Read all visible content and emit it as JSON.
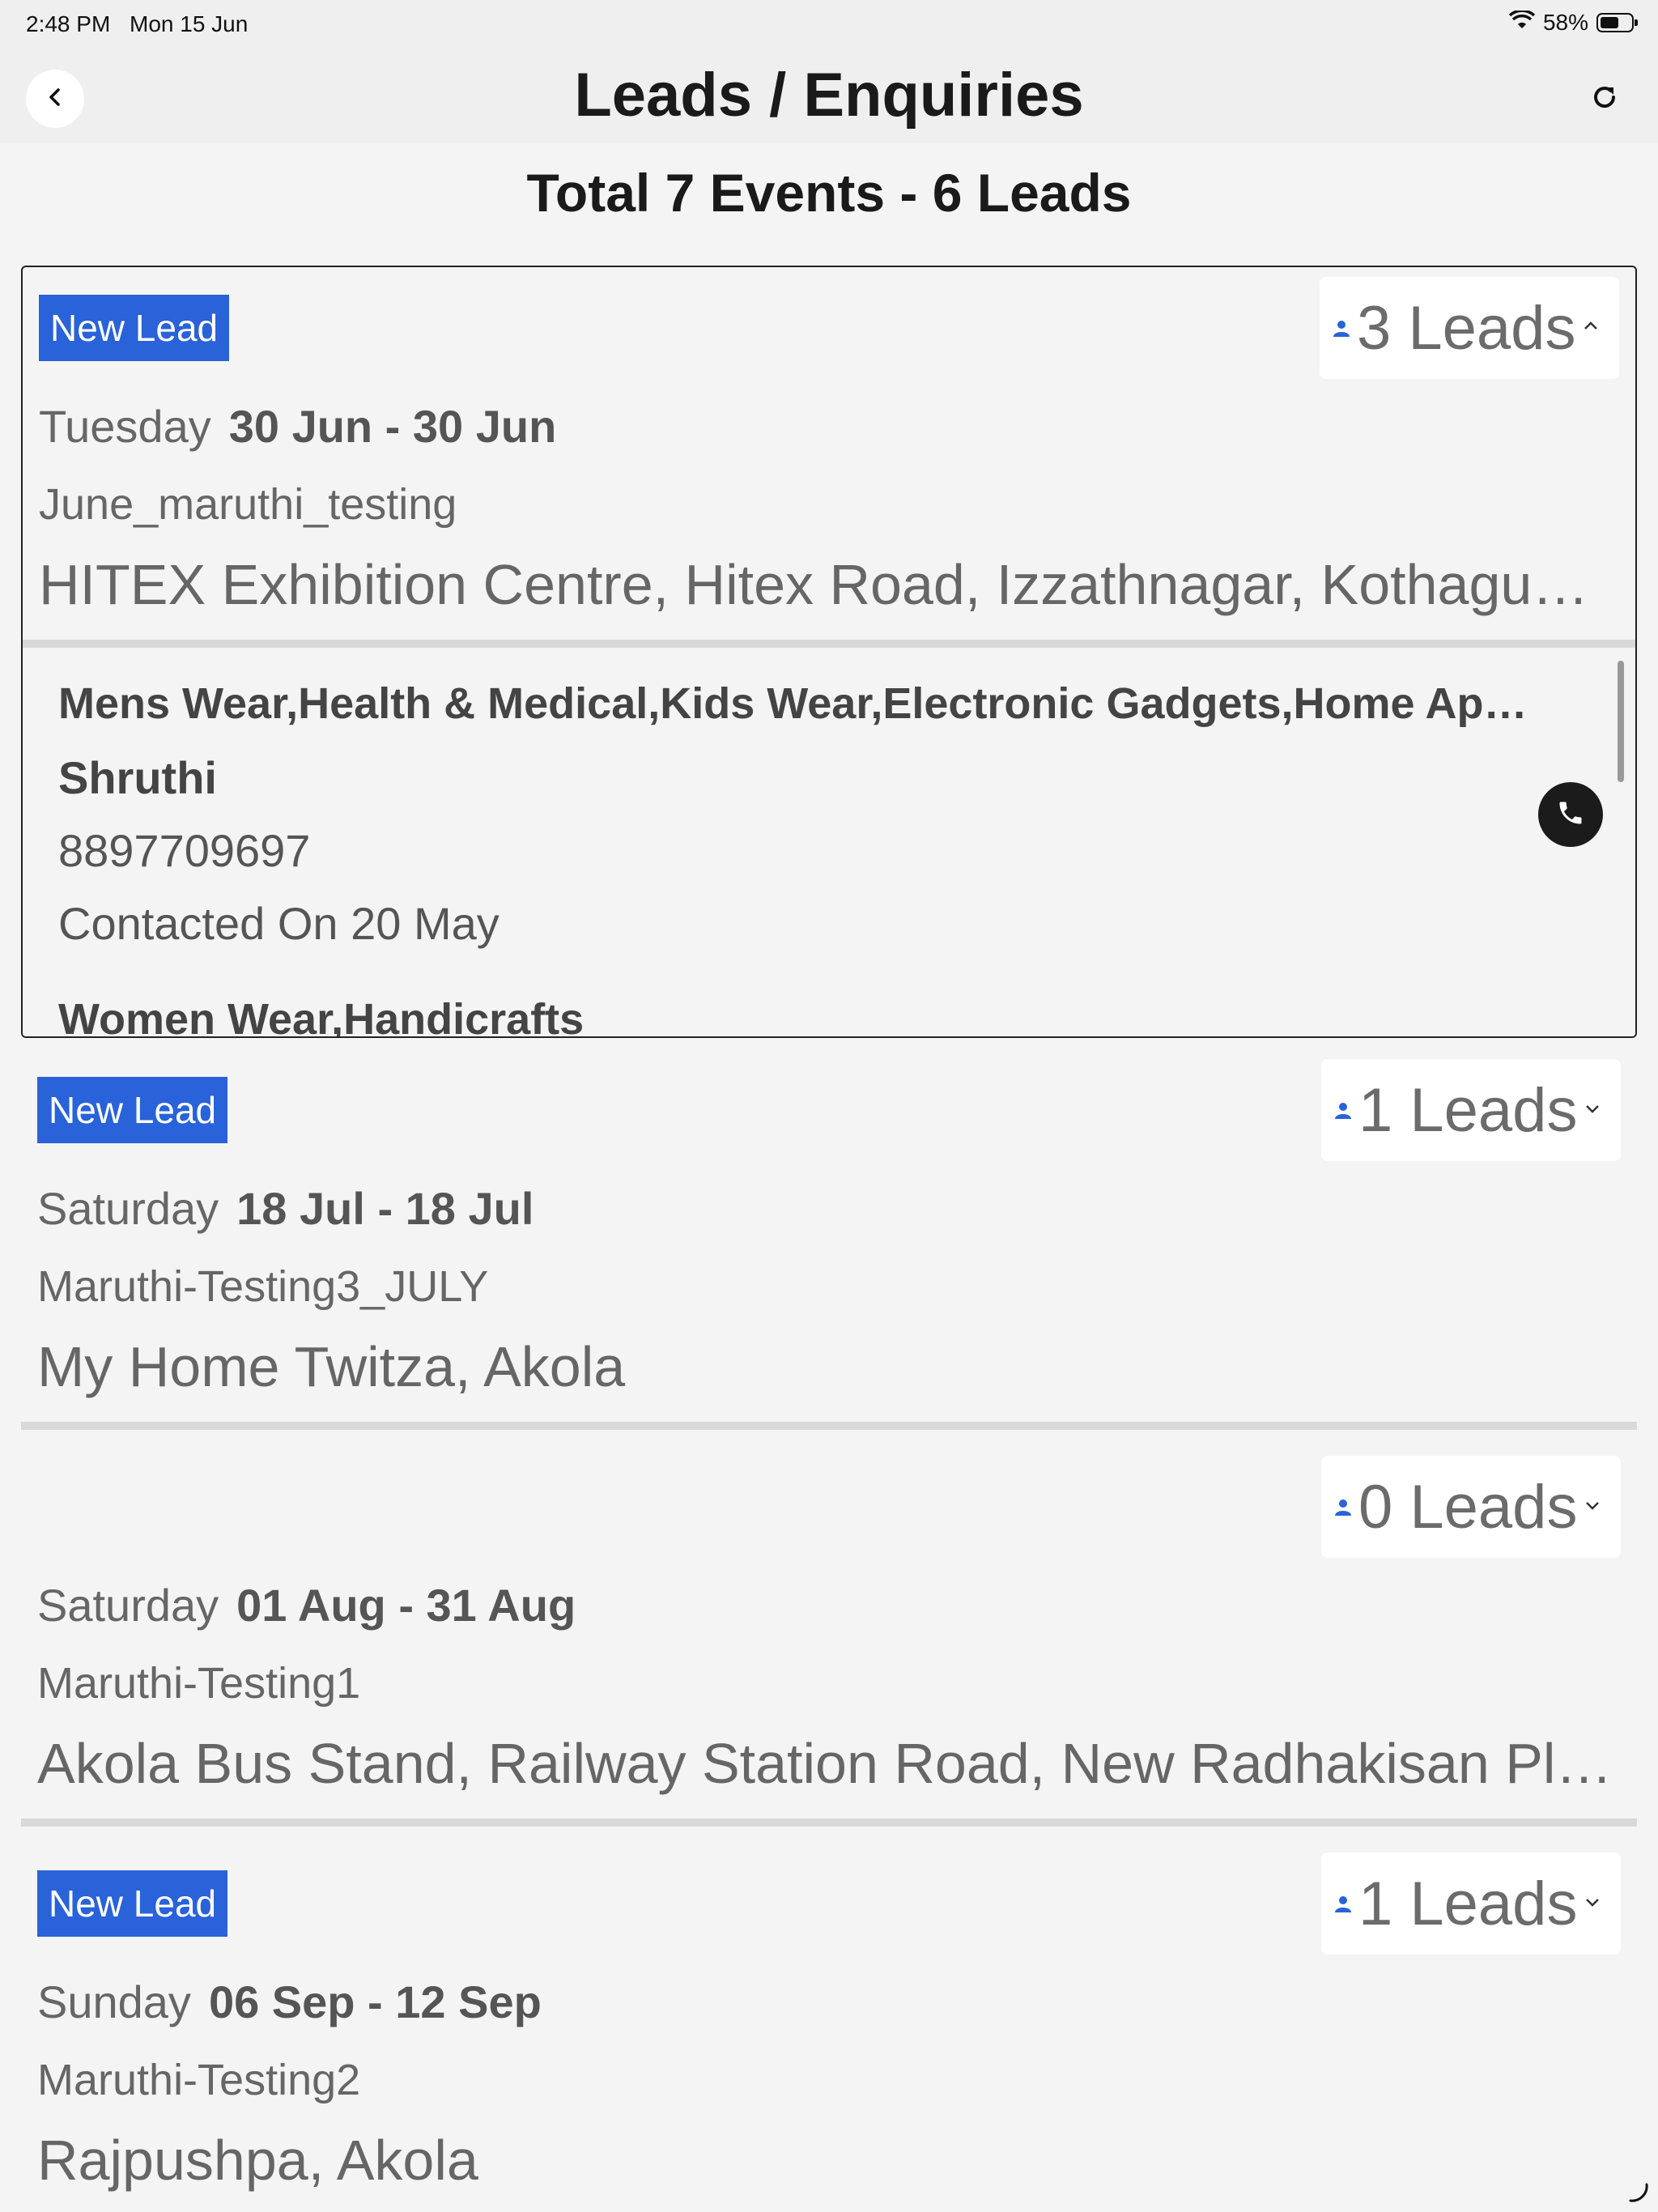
{
  "status": {
    "time": "2:48 PM",
    "date": "Mon 15 Jun",
    "battery": "58%",
    "battery_level": 0.58
  },
  "header": {
    "title": "Leads / Enquiries"
  },
  "summary": {
    "text": "Total 7 Events - 6 Leads"
  },
  "events": [
    {
      "badge": "New Lead",
      "leads_label": "3 Leads",
      "expanded": true,
      "day": "Tuesday",
      "dates": "30 Jun - 30 Jun",
      "name": "June_maruthi_testing",
      "venue": "HITEX Exhibition Centre, Hitex Road, Izzathnagar, Kothaguda, Hyderabad",
      "leads": [
        {
          "categories": "Mens Wear,Health & Medical,Kids Wear,Electronic Gadgets,Home Appliances",
          "person": "Shruthi",
          "phone": "8897709697",
          "contacted": "Contacted On 20 May"
        },
        {
          "categories": "Women Wear,Handicrafts"
        }
      ]
    },
    {
      "badge": "New Lead",
      "leads_label": "1 Leads",
      "expanded": false,
      "day": "Saturday",
      "dates": "18 Jul - 18 Jul",
      "name": "Maruthi-Testing3_JULY",
      "venue": "My Home Twitza, Akola"
    },
    {
      "badge": "",
      "leads_label": "0 Leads",
      "expanded": false,
      "day": "Saturday",
      "dates": "01 Aug - 31 Aug",
      "name": "Maruthi-Testing1",
      "venue": "Akola Bus Stand, Railway Station Road, New Radhakisan Plots, Akola"
    },
    {
      "badge": "New Lead",
      "leads_label": "1 Leads",
      "expanded": false,
      "day": "Sunday",
      "dates": "06 Sep - 12 Sep",
      "name": "Maruthi-Testing2",
      "venue": "Rajpushpa, Akola"
    }
  ],
  "colors": {
    "badge": "#2962d9",
    "person_icon": "#2962d9",
    "call_button": "#1b1b1b"
  },
  "icons": {
    "back": "chevron-left-icon",
    "refresh": "refresh-icon",
    "person": "person-icon",
    "call": "phone-icon"
  }
}
